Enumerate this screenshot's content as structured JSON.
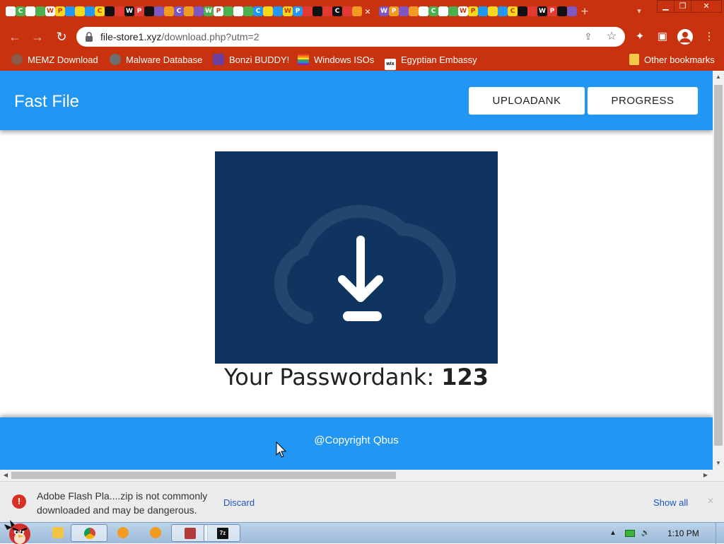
{
  "browser": {
    "tab_close_glyph": "×",
    "new_tab_glyph": "+",
    "url_host": "file-store1.xyz",
    "url_path": "/download.php?utm=2"
  },
  "bookmarks": [
    {
      "label": "MEMZ Download",
      "color": "#8a5a4a"
    },
    {
      "label": "Malware Database",
      "color": "#6f6f6f"
    },
    {
      "label": "Bonzi BUDDY!",
      "color": "#6b3fa0"
    },
    {
      "label": "Windows ISOs",
      "color": "#e9c81f"
    },
    {
      "label": "Egyptian Embassy",
      "color": "#ffffff"
    }
  ],
  "other_bookmarks": "Other bookmarks",
  "site": {
    "title": "Fast File",
    "nav": {
      "upload": "UPLOADANK",
      "progress": "PROGRESS"
    },
    "password_label": "Your Passwordank:",
    "password_value": "123",
    "footer": "@Copyright Qbus"
  },
  "download_shelf": {
    "line1": "Adobe Flash Pla....zip is not commonly",
    "line2": "downloaded and may be dangerous.",
    "discard": "Discard",
    "show_all": "Show all"
  },
  "taskbar": {
    "clock": "1:10 PM"
  },
  "colors": {
    "chrome_frame": "#c8320e",
    "site_blue": "#2196f3",
    "hero_navy": "#0f3460",
    "warning_red": "#d93025"
  }
}
